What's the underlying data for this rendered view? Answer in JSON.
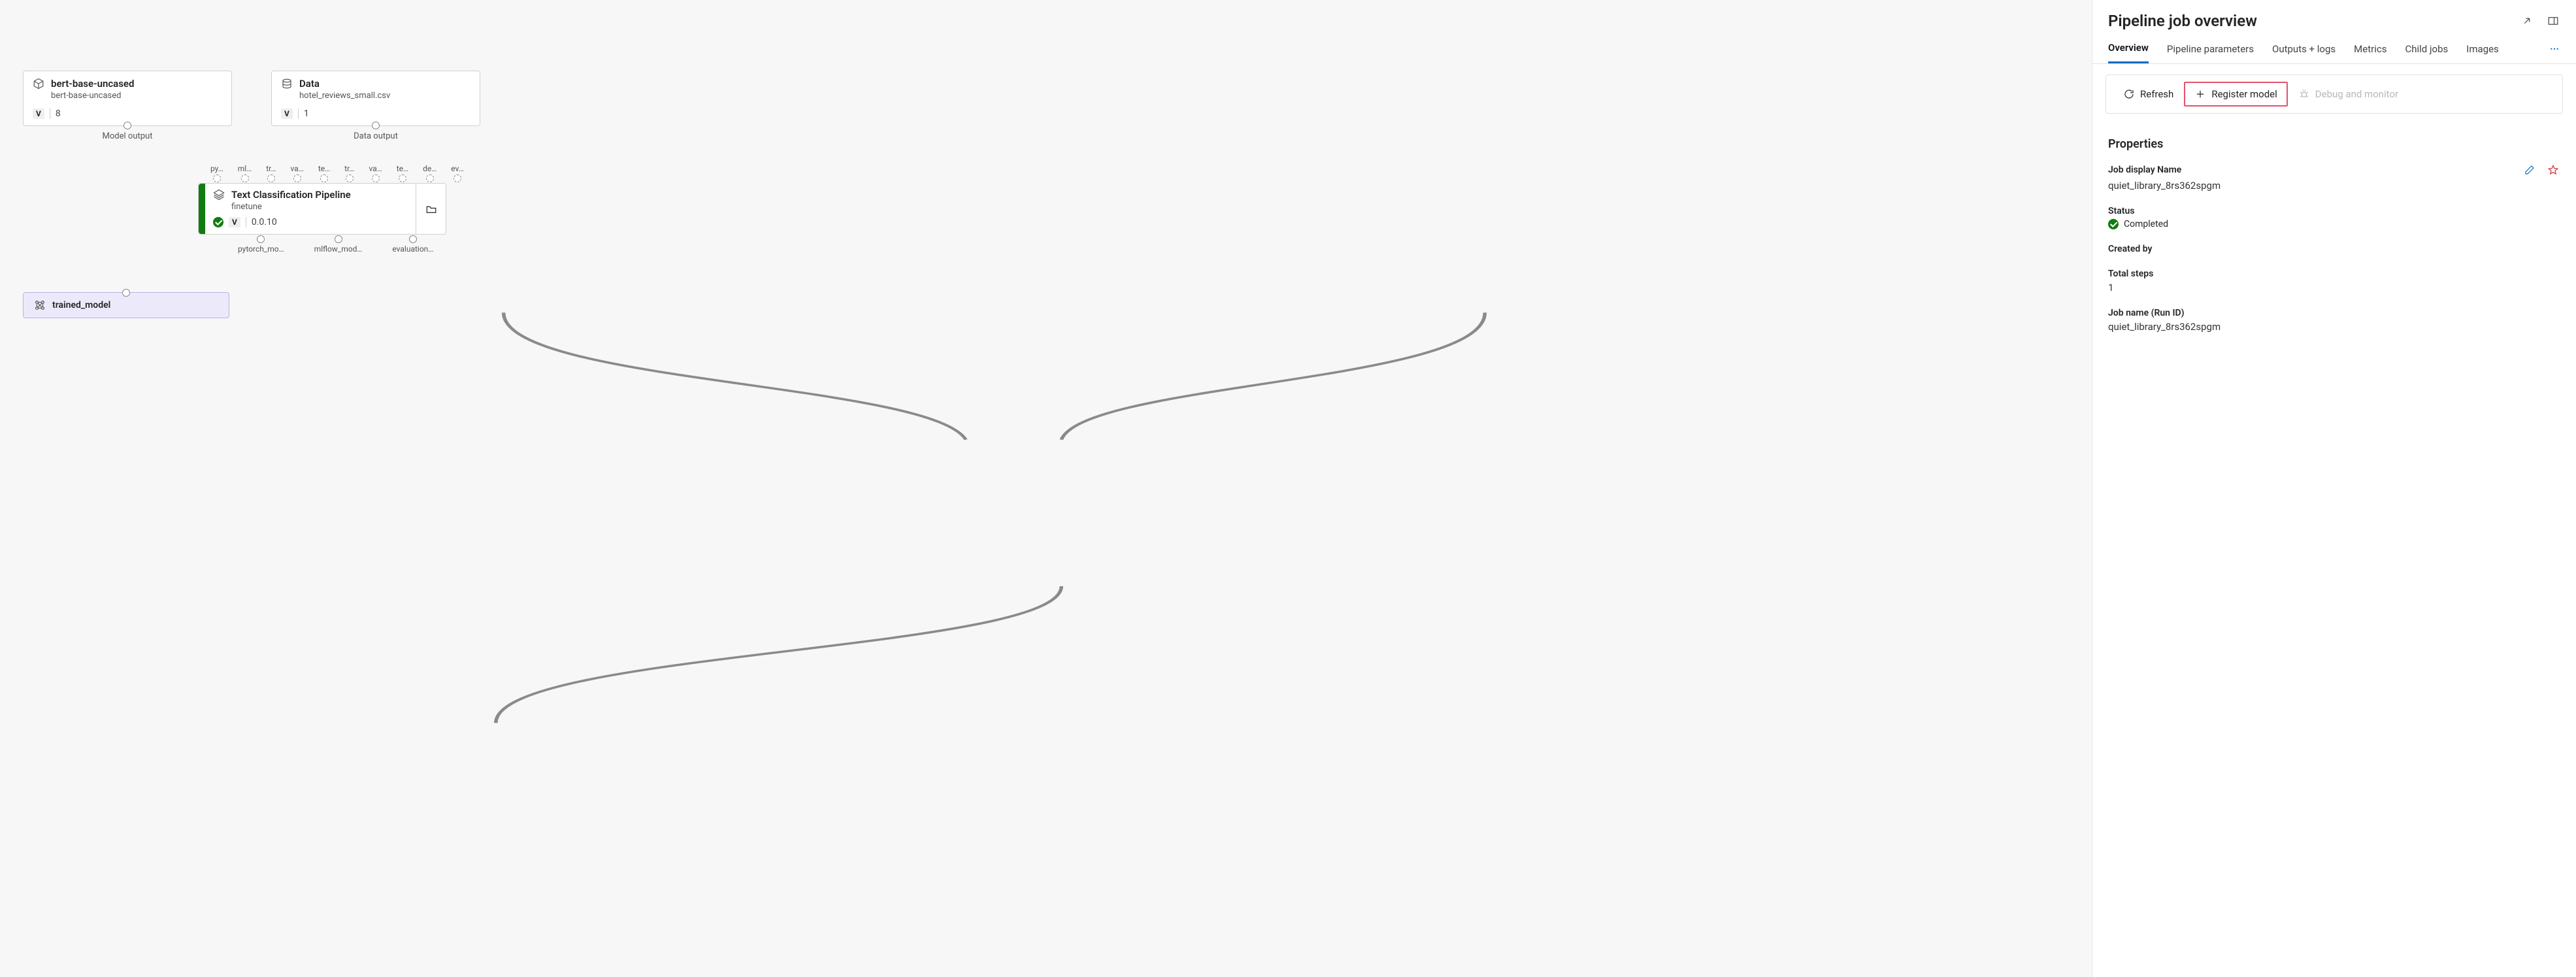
{
  "canvas": {
    "nodes": {
      "bert": {
        "title": "bert-base-uncased",
        "subtitle": "bert-base-uncased",
        "version": "8",
        "out_label": "Model output"
      },
      "data": {
        "title": "Data",
        "subtitle": "hotel_reviews_small.csv",
        "version": "1",
        "out_label": "Data output"
      },
      "pipe": {
        "title": "Text Classification Pipeline",
        "subtitle": "finetune",
        "version": "0.0.10",
        "in_labels": [
          "py…",
          "ml…",
          "tr…",
          "va…",
          "te…",
          "tr…",
          "va…",
          "te…",
          "de…",
          "ev…"
        ],
        "out_labels": [
          "pytorch_mo…",
          "mlflow_mod…",
          "evaluation…"
        ]
      },
      "sink": {
        "title": "trained_model"
      }
    }
  },
  "panel": {
    "title": "Pipeline job overview",
    "tabs": [
      "Overview",
      "Pipeline parameters",
      "Outputs + logs",
      "Metrics",
      "Child jobs",
      "Images"
    ],
    "active_tab": 0,
    "toolbar": {
      "refresh": "Refresh",
      "register": "Register model",
      "debug": "Debug and monitor"
    },
    "properties_heading": "Properties",
    "props": {
      "display_name_label": "Job display Name",
      "display_name": "quiet_library_8rs362spgm",
      "status_label": "Status",
      "status": "Completed",
      "created_by_label": "Created by",
      "created_by": "",
      "steps_label": "Total steps",
      "steps": "1",
      "runid_label": "Job name (Run ID)",
      "runid": "quiet_library_8rs362spgm"
    }
  },
  "v_badge": "V"
}
